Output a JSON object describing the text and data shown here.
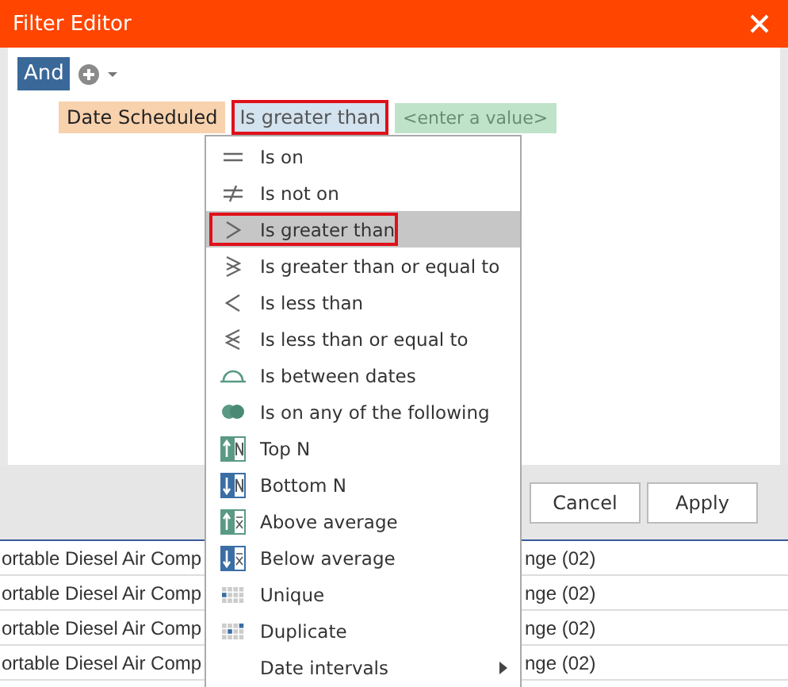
{
  "window": {
    "title": "Filter Editor"
  },
  "group": {
    "operator": "And"
  },
  "condition": {
    "field": "Date Scheduled",
    "operator": "Is greater than",
    "operator_focused": true,
    "value_placeholder": "<enter a value>"
  },
  "menu": {
    "items": [
      {
        "label": "Is on",
        "kind": "equals",
        "selected": false
      },
      {
        "label": "Is not on",
        "kind": "not-equals",
        "selected": false
      },
      {
        "label": "Is greater than",
        "kind": "greater",
        "selected": true
      },
      {
        "label": "Is greater than or equal to",
        "kind": "greater-equal",
        "selected": false
      },
      {
        "label": "Is less than",
        "kind": "less",
        "selected": false
      },
      {
        "label": "Is less than or equal to",
        "kind": "less-equal",
        "selected": false
      },
      {
        "label": "Is between dates",
        "kind": "between",
        "selected": false
      },
      {
        "label": "Is on any of the following",
        "kind": "any-of",
        "selected": false
      },
      {
        "label": "Top N",
        "kind": "top-n",
        "selected": false
      },
      {
        "label": "Bottom N",
        "kind": "bottom-n",
        "selected": false
      },
      {
        "label": "Above average",
        "kind": "above-average",
        "selected": false
      },
      {
        "label": "Below average",
        "kind": "below-average",
        "selected": false
      },
      {
        "label": "Unique",
        "kind": "unique",
        "selected": false
      },
      {
        "label": "Duplicate",
        "kind": "duplicate",
        "selected": false
      },
      {
        "label": "Date intervals",
        "kind": "submenu",
        "selected": false
      }
    ]
  },
  "buttons": [
    "Cancel",
    "Apply"
  ],
  "grid": {
    "rows": [
      {
        "column_1": "ortable Diesel Air Comp",
        "column_2": "nge (02)"
      },
      {
        "column_1": "ortable Diesel Air Comp",
        "column_2": "nge (02)"
      },
      {
        "column_1": "ortable Diesel Air Comp",
        "column_2": "nge (02)"
      },
      {
        "column_1": "ortable Diesel Air Comp",
        "column_2": "nge (02)"
      }
    ]
  }
}
